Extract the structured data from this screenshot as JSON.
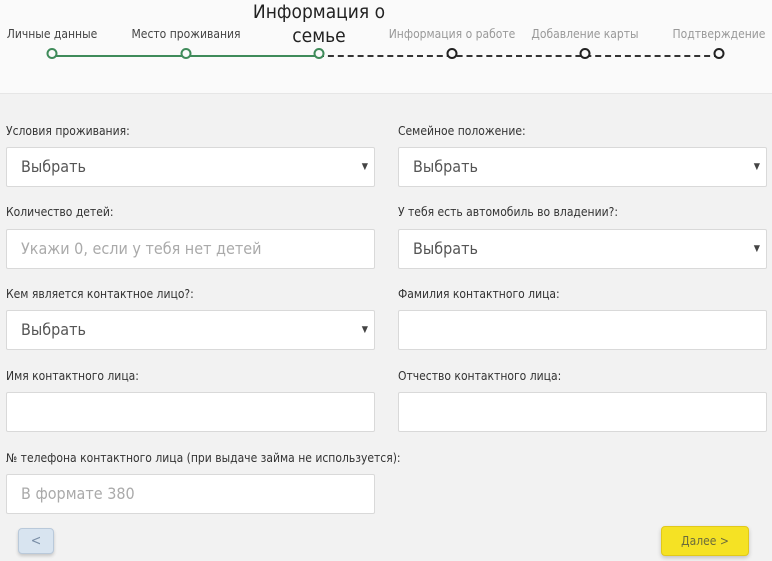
{
  "steps": [
    {
      "label": "Личные данные",
      "state": "done"
    },
    {
      "label": "Место проживания",
      "state": "done"
    },
    {
      "label": "Информация о семье",
      "state": "active"
    },
    {
      "label": "Информация о работе",
      "state": "todo"
    },
    {
      "label": "Добавление карты",
      "state": "todo"
    },
    {
      "label": "Подтверждение",
      "state": "todo"
    }
  ],
  "form": {
    "living_conditions": {
      "label": "Условия проживания:",
      "value": "Выбрать"
    },
    "marital_status": {
      "label": "Семейное положение:",
      "value": "Выбрать"
    },
    "children_count": {
      "label": "Количество детей:",
      "placeholder": "Укажи 0, если у тебя нет детей"
    },
    "has_car": {
      "label": "У тебя есть автомобиль во владении?:",
      "value": "Выбрать"
    },
    "contact_relation": {
      "label": "Кем является контактное лицо?:",
      "value": "Выбрать"
    },
    "contact_last_name": {
      "label": "Фамилия контактного лица:",
      "value": ""
    },
    "contact_first_name": {
      "label": "Имя контактного лица:",
      "value": ""
    },
    "contact_patronymic": {
      "label": "Отчество контактного лица:",
      "value": ""
    },
    "contact_phone": {
      "label": "№ телефона контактного лица (при выдаче займа не используется):",
      "placeholder": "В формате 380"
    }
  },
  "buttons": {
    "back": "<",
    "next": "Далее >"
  }
}
